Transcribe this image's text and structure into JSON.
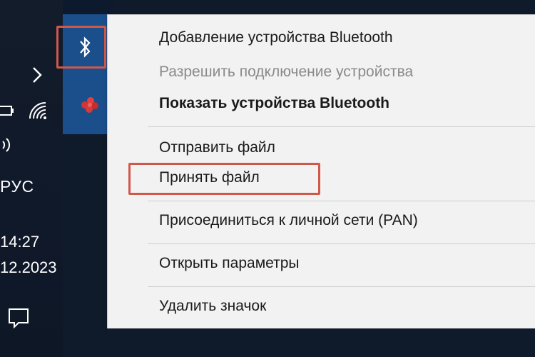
{
  "taskbar": {
    "language": "РУС",
    "time": "14:27",
    "date": "12.2023",
    "icons": [
      "chevron-right-icon",
      "battery-icon",
      "wifi-icon",
      "volume-icon",
      "notification-icon"
    ]
  },
  "tray": {
    "icons": [
      "bluetooth-icon",
      "red-app-icon"
    ],
    "panel_color": "#1b4f8c"
  },
  "context_menu": {
    "items": [
      {
        "label": "Добавление устройства Bluetooth",
        "state": "normal"
      },
      {
        "label": "Разрешить подключение устройства",
        "state": "disabled"
      },
      {
        "label": "Показать устройства Bluetooth",
        "state": "default-bold"
      },
      {
        "label": "Отправить файл",
        "state": "normal"
      },
      {
        "label": "Принять файл",
        "state": "normal"
      },
      {
        "label": "Присоединиться к личной сети (PAN)",
        "state": "normal"
      },
      {
        "label": "Открыть параметры",
        "state": "normal"
      },
      {
        "label": "Удалить значок",
        "state": "normal"
      }
    ]
  },
  "annotation_color": "#d0584a"
}
